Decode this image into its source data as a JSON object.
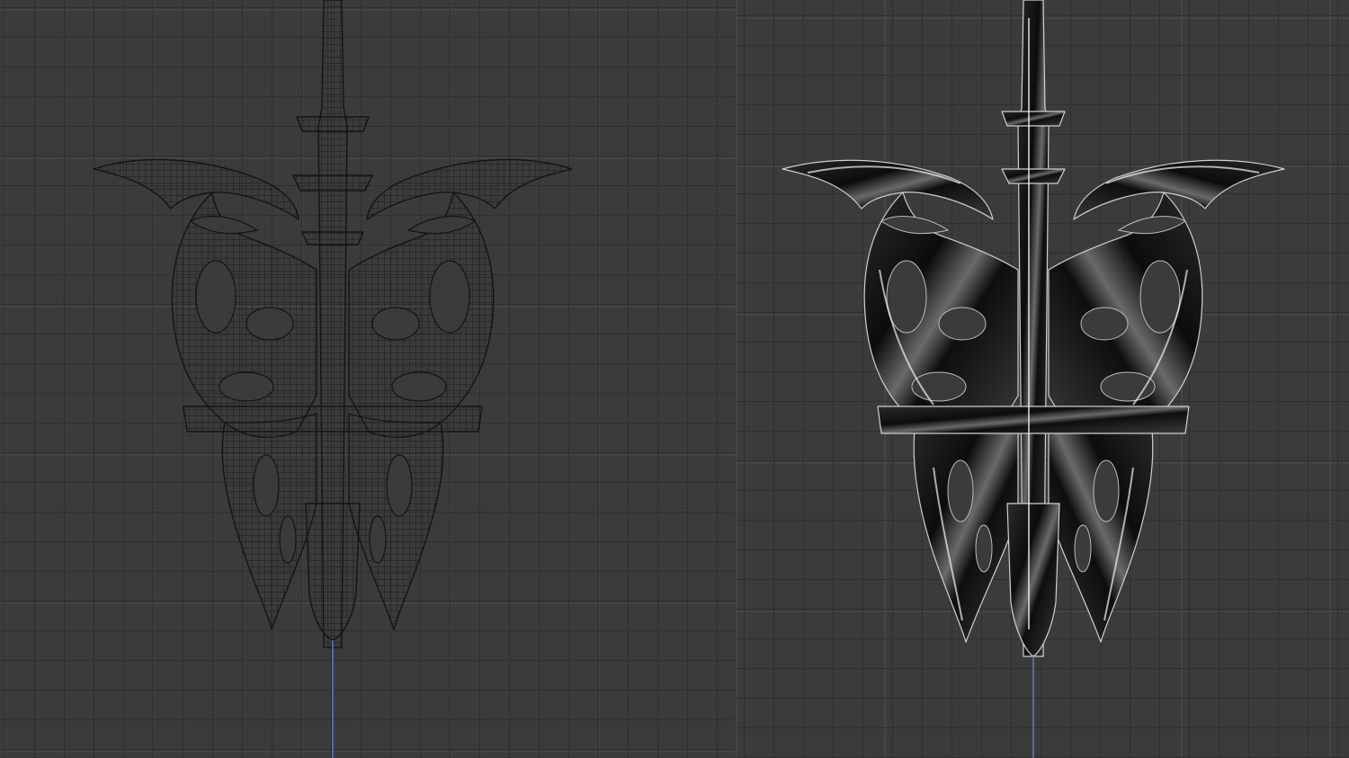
{
  "viewports": [
    {
      "mode": "wireframe",
      "object": "ribcage-pendant"
    },
    {
      "mode": "shaded-metallic",
      "object": "ribcage-pendant"
    }
  ],
  "colors": {
    "background": "#3b3b3b",
    "grid_minor": "#2f2f2f",
    "grid_major": "#454545",
    "wire": "#1c1c1c",
    "metal_dark": "#101010",
    "metal_highlight": "#d8d8d8",
    "axis_z": "#4a79b8"
  }
}
